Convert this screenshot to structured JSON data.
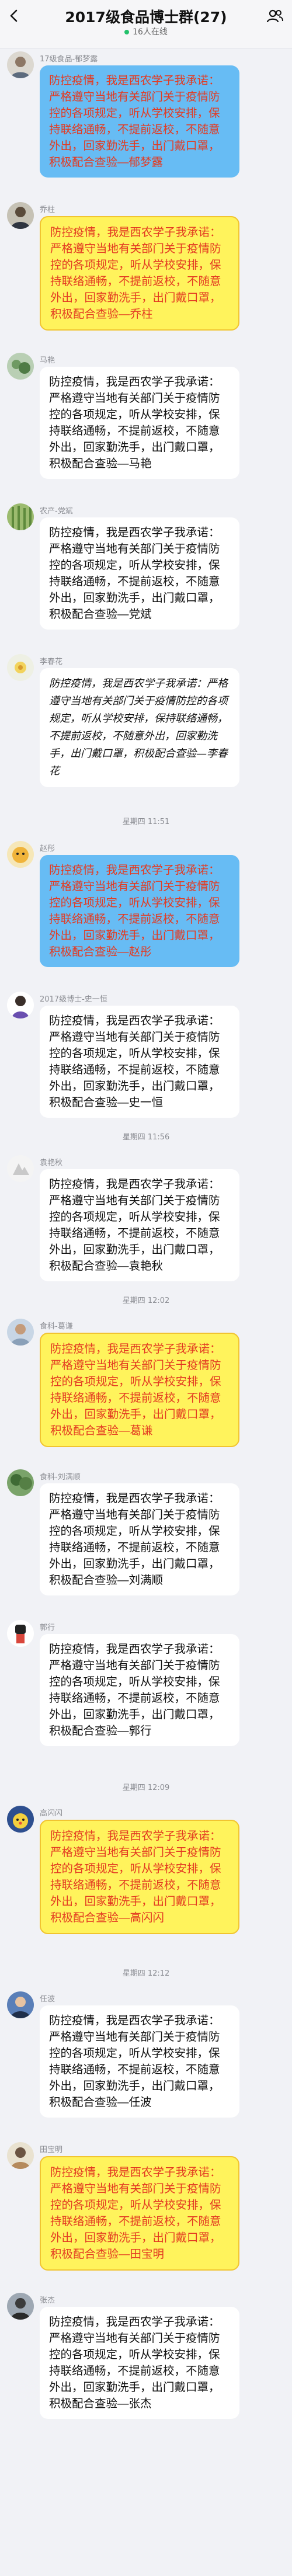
{
  "header": {
    "title": "2017级食品博士群(27)",
    "online": "16人在线"
  },
  "colors": {
    "blue_bubble": "#67bcf4",
    "yellow_bubble": "#fff35c",
    "red_text": "#e33b22",
    "online_dot": "#23c16b"
  },
  "messages": [
    {
      "sender": "17级食品-郁梦露",
      "text": "防控疫情，我是西农学子我承诺：严格遵守当地有关部门关于疫情防控的各项规定，听从学校安排，保持联络通畅，不提前返校，不随意外出，回家勤洗手，出门戴口罩，积极配合查验—郁梦露"
    },
    {
      "sender": "乔柱",
      "text": "防控疫情，我是西农学子我承诺：严格遵守当地有关部门关于疫情防控的各项规定，听从学校安排，保持联络通畅，不提前返校，不随意外出，回家勤洗手，出门戴口罩，积极配合查验—乔柱"
    },
    {
      "sender": "马艳",
      "text": "防控疫情，我是西农学子我承诺：严格遵守当地有关部门关于疫情防控的各项规定，听从学校安排，保持联络通畅，不提前返校，不随意外出，回家勤洗手，出门戴口罩，积极配合查验—马艳"
    },
    {
      "sender": "农产-党斌",
      "text": "防控疫情，我是西农学子我承诺：严格遵守当地有关部门关于疫情防控的各项规定，听从学校安排，保持联络通畅，不提前返校，不随意外出，回家勤洗手，出门戴口罩，积极配合查验—党斌"
    },
    {
      "sender": "李春花",
      "text": "防控疫情，我是西农学子我承诺：严格遵守当地有关部门关于疫情防控的各项规定，听从学校安排，保持联络通畅，不提前返校，不随意外出，回家勤洗手，出门戴口罩，积极配合查验—李春花"
    },
    {
      "sender": "赵彤",
      "text": "防控疫情，我是西农学子我承诺：严格遵守当地有关部门关于疫情防控的各项规定，听从学校安排，保持联络通畅，不提前返校，不随意外出，回家勤洗手，出门戴口罩，积极配合查验—赵彤"
    },
    {
      "sender": "2017级博士-史一恒",
      "text": "防控疫情，我是西农学子我承诺：严格遵守当地有关部门关于疫情防控的各项规定，听从学校安排，保持联络通畅，不提前返校，不随意外出，回家勤洗手，出门戴口罩，积极配合查验—史一恒"
    },
    {
      "sender": "袁艳秋",
      "text": "防控疫情，我是西农学子我承诺：严格遵守当地有关部门关于疫情防控的各项规定，听从学校安排，保持联络通畅，不提前返校，不随意外出，回家勤洗手，出门戴口罩，积极配合查验—袁艳秋"
    },
    {
      "sender": "食科-葛谦",
      "text": "防控疫情，我是西农学子我承诺：严格遵守当地有关部门关于疫情防控的各项规定，听从学校安排，保持联络通畅，不提前返校，不随意外出，回家勤洗手，出门戴口罩，积极配合查验—葛谦"
    },
    {
      "sender": "食科-刘满顺",
      "text": "防控疫情，我是西农学子我承诺：严格遵守当地有关部门关于疫情防控的各项规定，听从学校安排，保持联络通畅，不提前返校，不随意外出，回家勤洗手，出门戴口罩，积极配合查验—刘满顺"
    },
    {
      "sender": "郭行",
      "text": "防控疫情，我是西农学子我承诺：严格遵守当地有关部门关于疫情防控的各项规定，听从学校安排，保持联络通畅，不提前返校，不随意外出，回家勤洗手，出门戴口罩，积极配合查验—郭行"
    },
    {
      "sender": "高闪闪",
      "text": "防控疫情，我是西农学子我承诺：严格遵守当地有关部门关于疫情防控的各项规定，听从学校安排，保持联络通畅，不提前返校，不随意外出，回家勤洗手，出门戴口罩，积极配合查验—高闪闪"
    },
    {
      "sender": "任波",
      "text": "防控疫情，我是西农学子我承诺：严格遵守当地有关部门关于疫情防控的各项规定，听从学校安排，保持联络通畅，不提前返校，不随意外出，回家勤洗手，出门戴口罩，积极配合查验—任波"
    },
    {
      "sender": "田宝明",
      "text": "防控疫情，我是西农学子我承诺：严格遵守当地有关部门关于疫情防控的各项规定，听从学校安排，保持联络通畅，不提前返校，不随意外出，回家勤洗手，出门戴口罩，积极配合查验—田宝明"
    },
    {
      "sender": "张杰",
      "text": "防控疫情，我是西农学子我承诺：严格遵守当地有关部门关于疫情防控的各项规定，听从学校安排，保持联络通畅，不提前返校，不随意外出，回家勤洗手，出门戴口罩，积极配合查验—张杰"
    }
  ],
  "timestamps": [
    "星期四 11:51",
    "星期四 11:56",
    "星期四 12:02",
    "星期四 12:09",
    "星期四 12:12"
  ]
}
